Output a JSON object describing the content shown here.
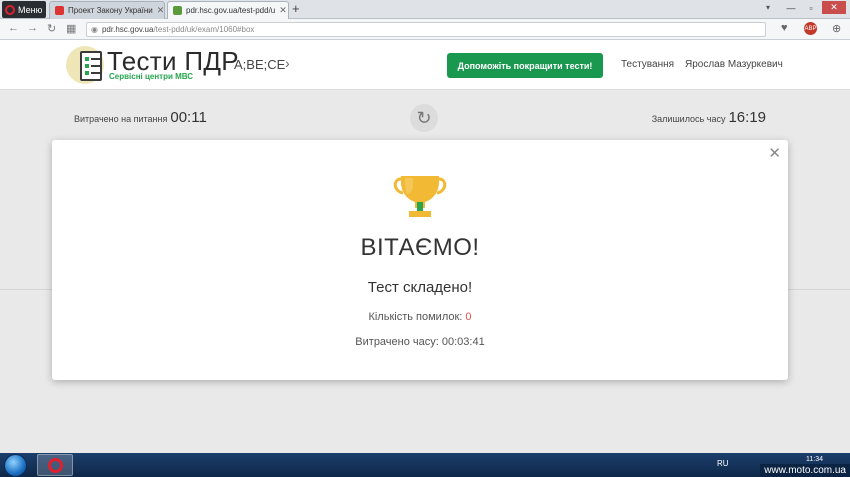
{
  "browser": {
    "menu_label": "Меню",
    "tabs": [
      {
        "title": "Проект Закону України"
      },
      {
        "title": "pdr.hsc.gov.ua/test-pdd/u"
      }
    ],
    "url_domain": "pdr.hsc.gov.ua",
    "url_path": "/test-pdd/uk/exam/1060#box",
    "badge_text": "ABP"
  },
  "site": {
    "logo_title": "Тести ПДР",
    "logo_subtitle": "Сервісні центри МВС",
    "category": "A;BE;CE",
    "improve_button": "Допоможіть покращити тести!",
    "nav": {
      "testing": "Тестування",
      "user": "Ярослав Мазуркевич"
    }
  },
  "timers": {
    "spent_label": "Витрачено на питання",
    "spent_value": "00:11",
    "remaining_label": "Залишилось часу",
    "remaining_value": "16:19"
  },
  "modal": {
    "title": "ВІТАЄМО!",
    "subtitle": "Тест складено!",
    "errors_label": "Кількість помилок:",
    "errors_value": "0",
    "time_label": "Витрачено часу:",
    "time_value": "00:03:41"
  },
  "taskbar": {
    "lang": "RU",
    "time": "11:34",
    "watermark": "www.moto.com.ua"
  },
  "colors": {
    "brand_green": "#1a9850",
    "error_red": "#d9534f",
    "trophy_gold": "#f2b935"
  }
}
